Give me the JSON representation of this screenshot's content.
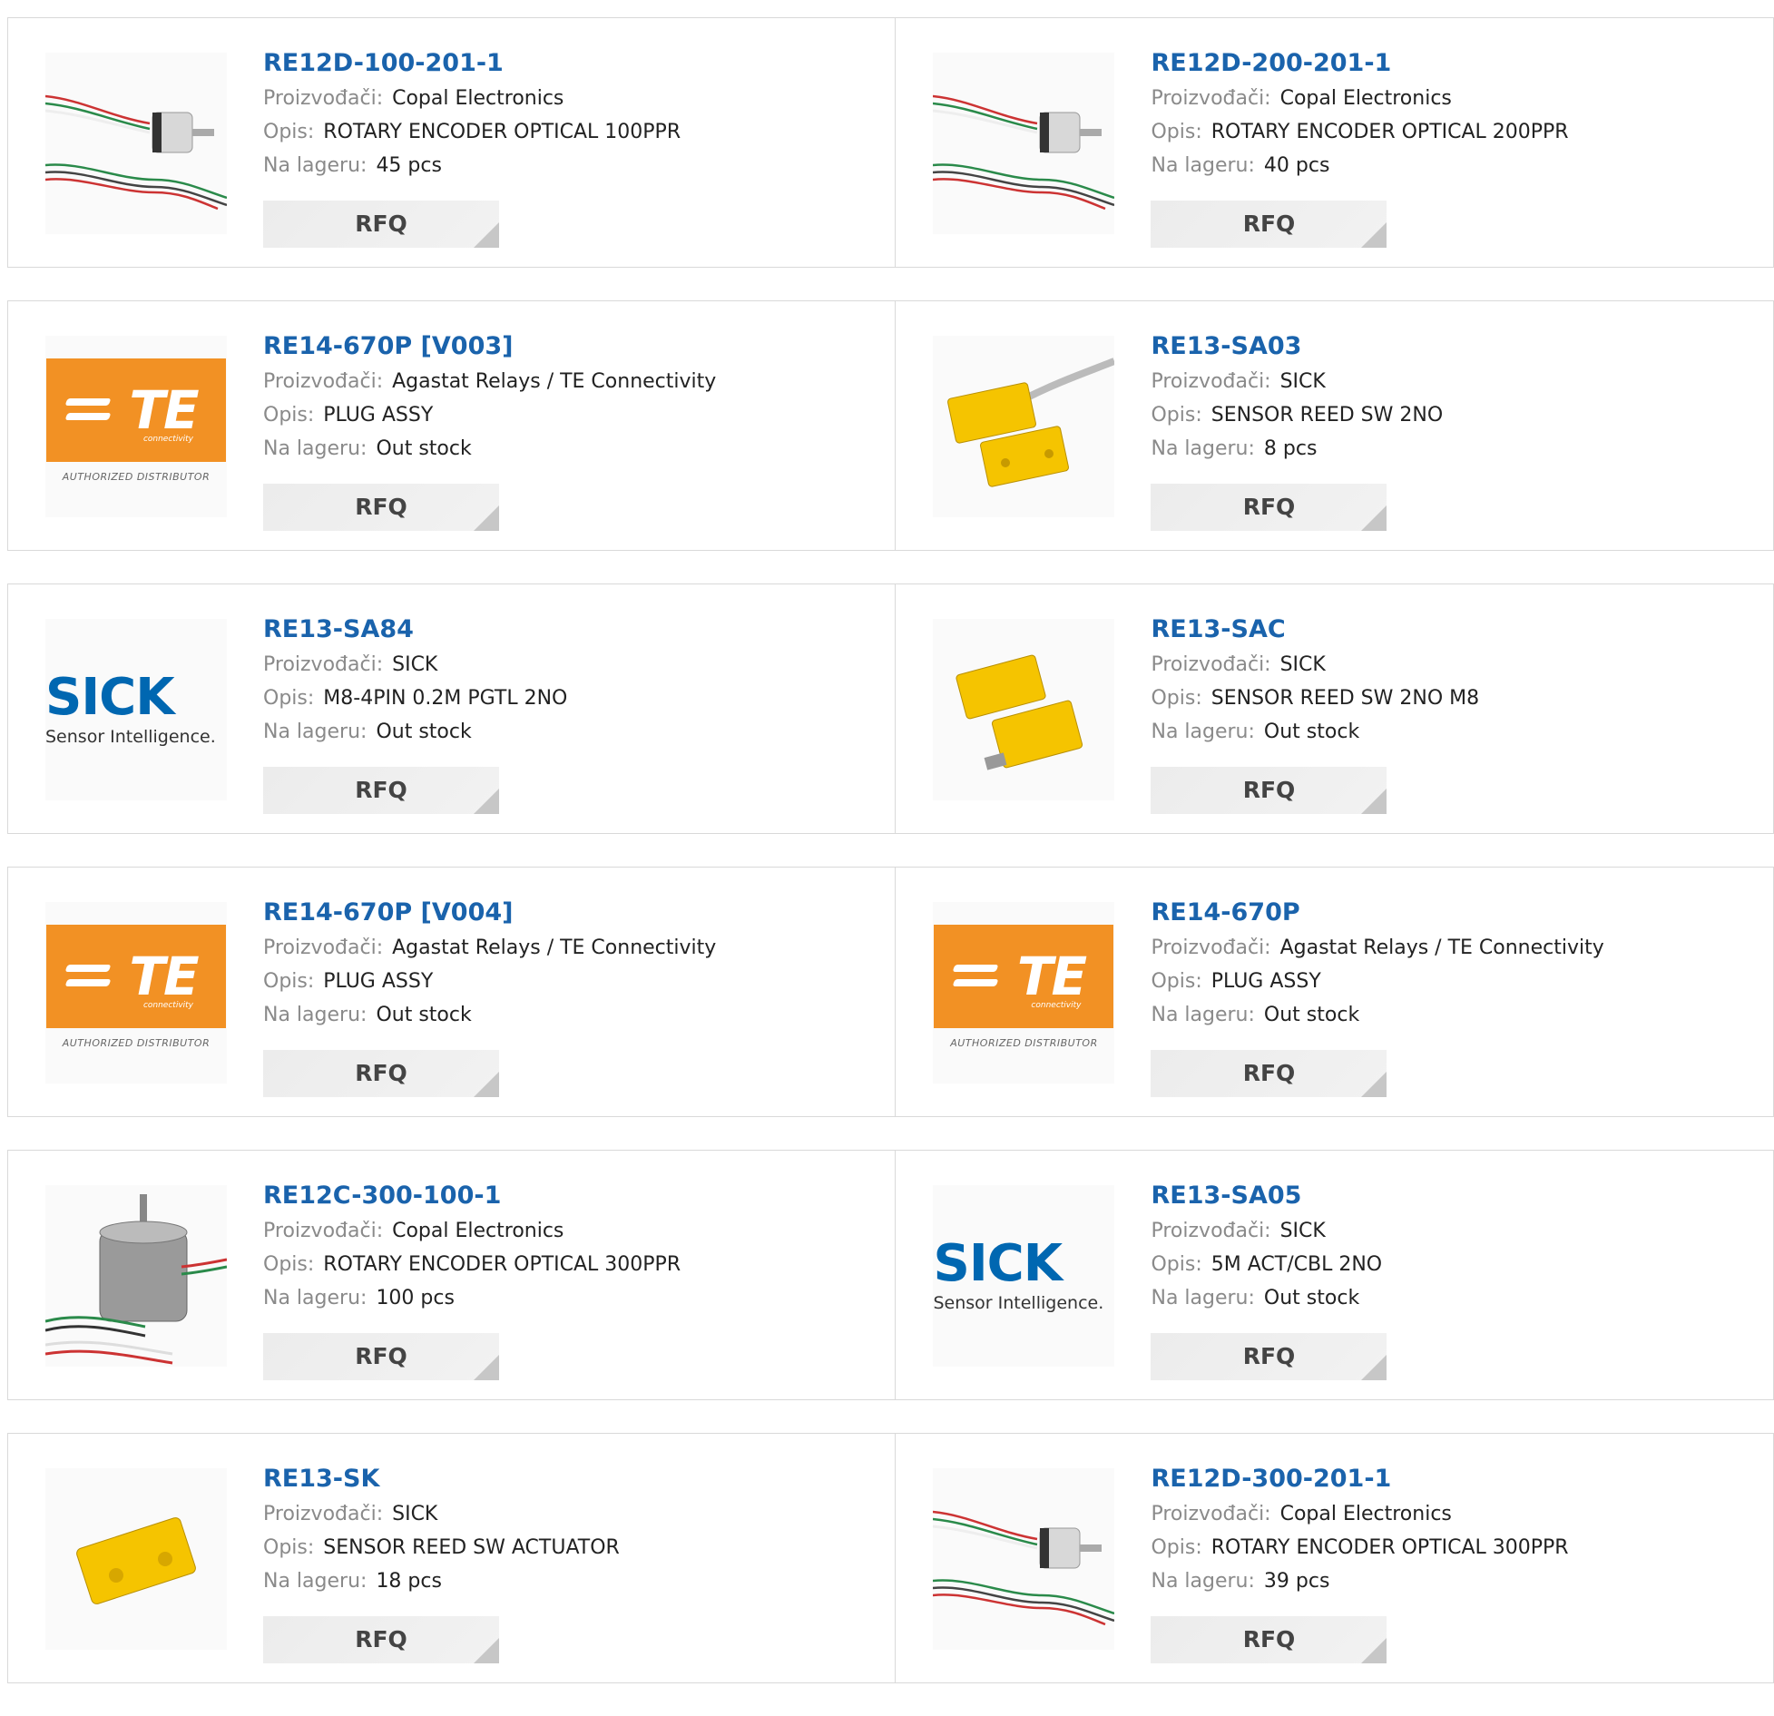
{
  "labels": {
    "manufacturer": "Proizvođači:",
    "description": "Opis:",
    "stock": "Na lageru:",
    "rfq": "RFQ"
  },
  "logos": {
    "te_text": "TE",
    "te_sub": "connectivity",
    "te_dist": "AUTHORIZED DISTRIBUTOR",
    "sick_word": "SICK",
    "sick_sub": "Sensor Intelligence."
  },
  "products": [
    {
      "part": "RE12D-100-201-1",
      "manufacturer": "Copal Electronics",
      "description": "ROTARY ENCODER OPTICAL 100PPR",
      "stock": "45 pcs",
      "image": "encoder-small"
    },
    {
      "part": "RE12D-200-201-1",
      "manufacturer": "Copal Electronics",
      "description": "ROTARY ENCODER OPTICAL 200PPR",
      "stock": "40 pcs",
      "image": "encoder-small"
    },
    {
      "part": "RE14-670P [V003]",
      "manufacturer": "Agastat Relays / TE Connectivity",
      "description": "PLUG ASSY",
      "stock": "Out stock",
      "image": "te-logo"
    },
    {
      "part": "RE13-SA03",
      "manufacturer": "SICK",
      "description": "SENSOR REED SW 2NO",
      "stock": "8 pcs",
      "image": "reed-sensor-cable"
    },
    {
      "part": "RE13-SA84",
      "manufacturer": "SICK",
      "description": "M8-4PIN 0.2M PGTL 2NO",
      "stock": "Out stock",
      "image": "sick-logo"
    },
    {
      "part": "RE13-SAC",
      "manufacturer": "SICK",
      "description": "SENSOR REED SW 2NO M8",
      "stock": "Out stock",
      "image": "reed-sensor-m8"
    },
    {
      "part": "RE14-670P [V004]",
      "manufacturer": "Agastat Relays / TE Connectivity",
      "description": "PLUG ASSY",
      "stock": "Out stock",
      "image": "te-logo"
    },
    {
      "part": "RE14-670P",
      "manufacturer": "Agastat Relays / TE Connectivity",
      "description": "PLUG ASSY",
      "stock": "Out stock",
      "image": "te-logo"
    },
    {
      "part": "RE12C-300-100-1",
      "manufacturer": "Copal Electronics",
      "description": "ROTARY ENCODER OPTICAL 300PPR",
      "stock": "100 pcs",
      "image": "encoder-large"
    },
    {
      "part": "RE13-SA05",
      "manufacturer": "SICK",
      "description": "5M ACT/CBL 2NO",
      "stock": "Out stock",
      "image": "sick-logo"
    },
    {
      "part": "RE13-SK",
      "manufacturer": "SICK",
      "description": "SENSOR REED SW ACTUATOR",
      "stock": "18 pcs",
      "image": "reed-actuator"
    },
    {
      "part": "RE12D-300-201-1",
      "manufacturer": "Copal Electronics",
      "description": "ROTARY ENCODER OPTICAL 300PPR",
      "stock": "39 pcs",
      "image": "encoder-small"
    }
  ]
}
